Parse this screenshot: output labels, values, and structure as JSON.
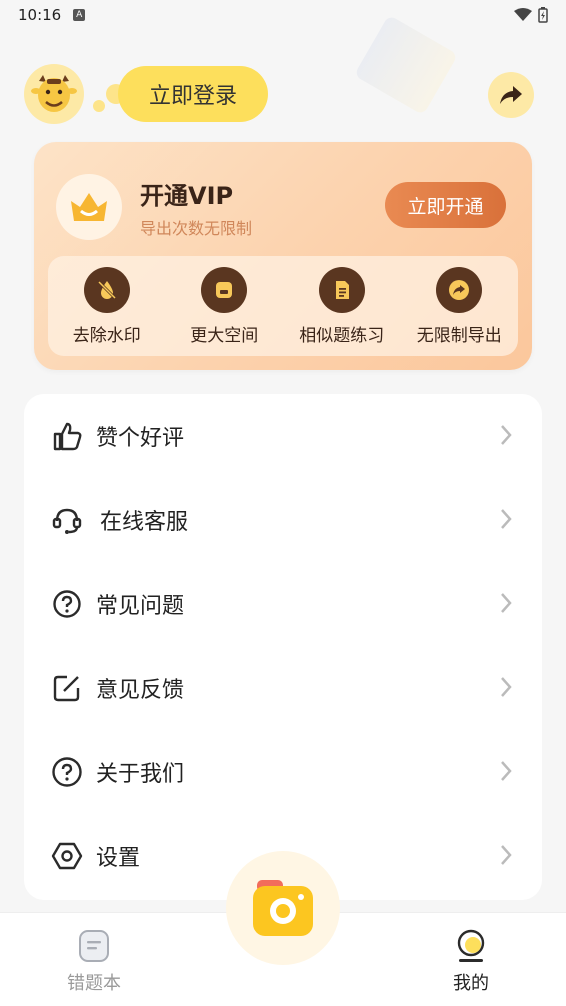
{
  "status_bar": {
    "time": "10:16"
  },
  "header": {
    "login_label": "立即登录",
    "avatar_icon": "cow-avatar-icon",
    "share_icon": "share-icon"
  },
  "vip": {
    "title": "开通VIP",
    "subtitle": "导出次数无限制",
    "open_label": "立即开通",
    "perks": [
      {
        "label": "去除水印",
        "icon": "watermark-remove-icon"
      },
      {
        "label": "更大空间",
        "icon": "storage-icon"
      },
      {
        "label": "相似题练习",
        "icon": "document-icon"
      },
      {
        "label": "无限制导出",
        "icon": "export-icon"
      }
    ]
  },
  "menu": {
    "items": [
      {
        "label": "赞个好评",
        "icon": "thumbs-up-icon"
      },
      {
        "label": "在线客服",
        "icon": "headset-icon"
      },
      {
        "label": "常见问题",
        "icon": "question-icon"
      },
      {
        "label": "意见反馈",
        "icon": "edit-icon"
      },
      {
        "label": "关于我们",
        "icon": "question-icon"
      },
      {
        "label": "设置",
        "icon": "settings-icon"
      }
    ]
  },
  "tabbar": {
    "tabs": [
      {
        "label": "错题本",
        "icon": "notebook-icon",
        "active": false
      },
      {
        "label": "我的",
        "icon": "profile-icon",
        "active": true
      }
    ],
    "camera_icon": "camera-icon"
  },
  "colors": {
    "accent": "#fddf5c",
    "vip_button": "#e07c44",
    "perk_icon_bg": "#5a3620"
  }
}
